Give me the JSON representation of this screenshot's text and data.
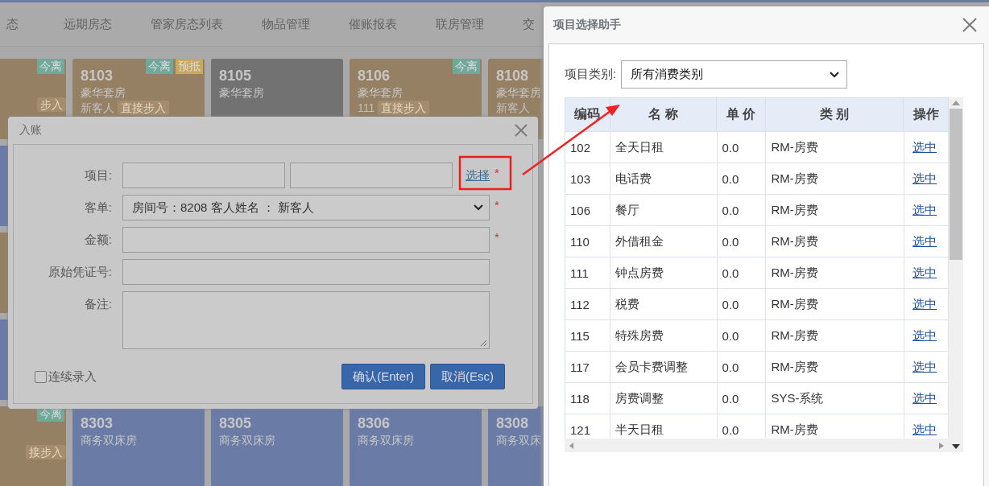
{
  "nav": {
    "tabs": [
      "态",
      "远期房态",
      "管家房态列表",
      "物品管理",
      "催账报表",
      "联房管理",
      "交"
    ]
  },
  "rooms": [
    [
      {
        "kind": "cut",
        "color": "#958064",
        "badges": [
          {
            "text": "今离",
            "color": "#6fa99a"
          }
        ],
        "tag": "步入"
      },
      {
        "kind": "room",
        "color": "#958064",
        "number": "8103",
        "type": "豪华套房",
        "guest": "新客人",
        "tag": "直接步入",
        "badges": [
          {
            "text": "今离",
            "color": "#6fa99a"
          },
          {
            "text": "预抵",
            "color": "#c8a860"
          }
        ]
      },
      {
        "kind": "room",
        "color": "#727272",
        "number": "8105",
        "type": "豪华套房"
      },
      {
        "kind": "room",
        "color": "#958064",
        "number": "8106",
        "type": "豪华套房",
        "guest": "111",
        "tag": "直接步入",
        "badges": [
          {
            "text": "今离",
            "color": "#6fa99a"
          }
        ]
      },
      {
        "kind": "room",
        "color": "#958064",
        "number": "8108",
        "type": "豪华套房",
        "guest": "新客人"
      }
    ],
    [
      {
        "kind": "cut",
        "color": "#6a7ba6"
      }
    ],
    [
      {
        "kind": "cut",
        "color": "#958064"
      }
    ],
    [
      {
        "kind": "cut",
        "color": "#6a7ba6"
      }
    ],
    [
      {
        "kind": "cut",
        "color": "#958064",
        "badges": [
          {
            "text": "今离",
            "color": "#6fa99a"
          }
        ],
        "tag": "接步入"
      },
      {
        "kind": "room",
        "color": "#6a7ba6",
        "number": "8303",
        "type": "商务双床房"
      },
      {
        "kind": "room",
        "color": "#6a7ba6",
        "number": "8305",
        "type": "商务双床房"
      },
      {
        "kind": "room",
        "color": "#6a7ba6",
        "number": "8306",
        "type": "商务双床房"
      },
      {
        "kind": "room",
        "color": "#6a7ba6",
        "number": "8308",
        "type": "商务双床"
      }
    ]
  ],
  "entry_dialog": {
    "title": "入账",
    "fields": [
      {
        "kind": "pair",
        "label": "项目:",
        "link": "选择",
        "mark": "*"
      },
      {
        "kind": "select",
        "label": "客单:",
        "value": "房间号：8208 客人姓名 ： 新客人",
        "mark": "*"
      },
      {
        "kind": "input",
        "label": "金额:",
        "mark": "*"
      },
      {
        "kind": "input",
        "label": "原始凭证号:"
      },
      {
        "kind": "textarea",
        "label": "备注:"
      }
    ],
    "continuous": {
      "label": "连续录入",
      "checked": false
    },
    "buttons": [
      "确认(Enter)",
      "取消(Esc)"
    ]
  },
  "picker": {
    "title": "项目选择助手",
    "category": {
      "label": "项目类别:",
      "value": "所有消费类别"
    },
    "columns": [
      "编码",
      "名 称",
      "单 价",
      "类 别",
      "操作"
    ],
    "rows": [
      [
        "102",
        "全天日租",
        "0.0",
        "RM-房费",
        "选中"
      ],
      [
        "103",
        "电话费",
        "0.0",
        "RM-房费",
        "选中"
      ],
      [
        "106",
        "餐厅",
        "0.0",
        "RM-房费",
        "选中"
      ],
      [
        "110",
        "外借租金",
        "0.0",
        "RM-房费",
        "选中"
      ],
      [
        "111",
        "钟点房费",
        "0.0",
        "RM-房费",
        "选中"
      ],
      [
        "112",
        "税费",
        "0.0",
        "RM-房费",
        "选中"
      ],
      [
        "115",
        "特殊房费",
        "0.0",
        "RM-房费",
        "选中"
      ],
      [
        "117",
        "会员卡费调整",
        "0.0",
        "RM-房费",
        "选中"
      ],
      [
        "118",
        "房费调整",
        "0.0",
        "SYS-系统",
        "选中"
      ],
      [
        "121",
        "半天日租",
        "0.0",
        "RM-房费",
        "选中"
      ]
    ]
  }
}
